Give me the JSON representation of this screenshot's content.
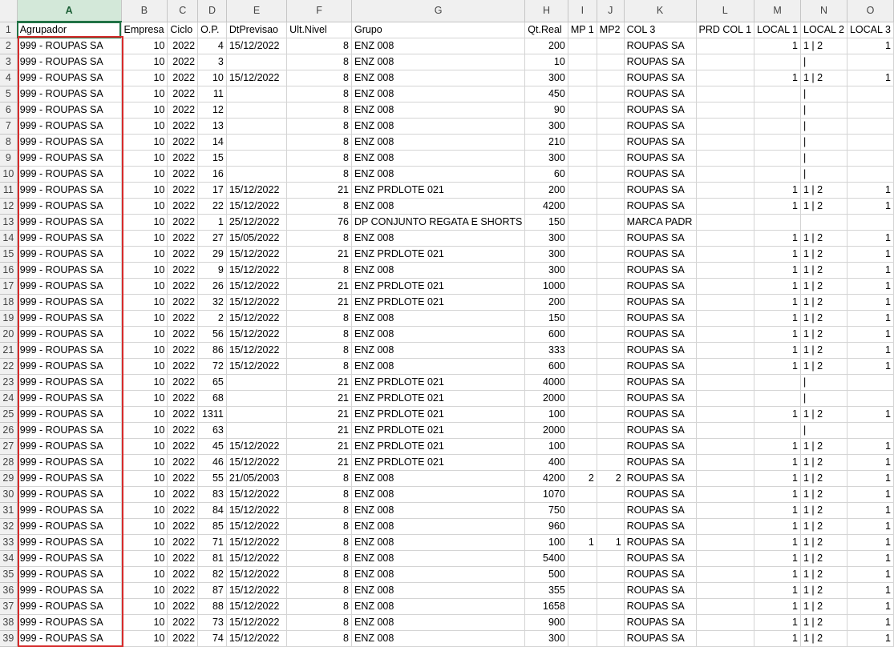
{
  "columns": [
    "A",
    "B",
    "C",
    "D",
    "E",
    "F",
    "G",
    "H",
    "I",
    "J",
    "K",
    "L",
    "M",
    "N",
    "O"
  ],
  "selected_column": "A",
  "selection_color": "#d62b2b",
  "accent_color": "#217346",
  "headers": [
    "Agrupador",
    "Empresa",
    "Ciclo",
    "O.P.",
    "DtPrevisao",
    "Ult.Nivel",
    "Grupo",
    "Qt.Real",
    "MP 1",
    "MP2",
    "COL 3",
    "PRD COL 1",
    "LOCAL 1",
    "LOCAL 2",
    "LOCAL 3"
  ],
  "rows": [
    {
      "n": "2",
      "cells": [
        "999 - ROUPAS SA",
        "10",
        "2022",
        "4",
        "15/12/2022",
        "8",
        "ENZ 008",
        "200",
        "",
        "",
        "ROUPAS SA",
        "",
        "1",
        "1 | 2",
        "1"
      ]
    },
    {
      "n": "3",
      "cells": [
        "999 - ROUPAS SA",
        "10",
        "2022",
        "3",
        "",
        "8",
        "ENZ 008",
        "10",
        "",
        "",
        "ROUPAS SA",
        "",
        "",
        "|",
        ""
      ]
    },
    {
      "n": "4",
      "cells": [
        "999 - ROUPAS SA",
        "10",
        "2022",
        "10",
        "15/12/2022",
        "8",
        "ENZ 008",
        "300",
        "",
        "",
        "ROUPAS SA",
        "",
        "1",
        "1 | 2",
        "1"
      ]
    },
    {
      "n": "5",
      "cells": [
        "999 - ROUPAS SA",
        "10",
        "2022",
        "11",
        "",
        "8",
        "ENZ 008",
        "450",
        "",
        "",
        "ROUPAS SA",
        "",
        "",
        "|",
        ""
      ]
    },
    {
      "n": "6",
      "cells": [
        "999 - ROUPAS SA",
        "10",
        "2022",
        "12",
        "",
        "8",
        "ENZ 008",
        "90",
        "",
        "",
        "ROUPAS SA",
        "",
        "",
        "|",
        ""
      ]
    },
    {
      "n": "7",
      "cells": [
        "999 - ROUPAS SA",
        "10",
        "2022",
        "13",
        "",
        "8",
        "ENZ 008",
        "300",
        "",
        "",
        "ROUPAS SA",
        "",
        "",
        "|",
        ""
      ]
    },
    {
      "n": "8",
      "cells": [
        "999 - ROUPAS SA",
        "10",
        "2022",
        "14",
        "",
        "8",
        "ENZ 008",
        "210",
        "",
        "",
        "ROUPAS SA",
        "",
        "",
        "|",
        ""
      ]
    },
    {
      "n": "9",
      "cells": [
        "999 - ROUPAS SA",
        "10",
        "2022",
        "15",
        "",
        "8",
        "ENZ 008",
        "300",
        "",
        "",
        "ROUPAS SA",
        "",
        "",
        "|",
        ""
      ]
    },
    {
      "n": "10",
      "cells": [
        "999 - ROUPAS SA",
        "10",
        "2022",
        "16",
        "",
        "8",
        "ENZ 008",
        "60",
        "",
        "",
        "ROUPAS SA",
        "",
        "",
        "|",
        ""
      ]
    },
    {
      "n": "11",
      "cells": [
        "999 - ROUPAS SA",
        "10",
        "2022",
        "17",
        "15/12/2022",
        "21",
        "ENZ PRDLOTE 021",
        "200",
        "",
        "",
        "ROUPAS SA",
        "",
        "1",
        "1 | 2",
        "1"
      ]
    },
    {
      "n": "12",
      "cells": [
        "999 - ROUPAS SA",
        "10",
        "2022",
        "22",
        "15/12/2022",
        "8",
        "ENZ 008",
        "4200",
        "",
        "",
        "ROUPAS SA",
        "",
        "1",
        "1 | 2",
        "1"
      ]
    },
    {
      "n": "13",
      "cells": [
        "999 - ROUPAS SA",
        "10",
        "2022",
        "1",
        "25/12/2022",
        "76",
        "DP CONJUNTO REGATA E SHORTS",
        "150",
        "",
        "",
        "MARCA PADR",
        "",
        "",
        "",
        ""
      ]
    },
    {
      "n": "14",
      "cells": [
        "999 - ROUPAS SA",
        "10",
        "2022",
        "27",
        "15/05/2022",
        "8",
        "ENZ 008",
        "300",
        "",
        "",
        "ROUPAS SA",
        "",
        "1",
        "1 | 2",
        "1"
      ]
    },
    {
      "n": "15",
      "cells": [
        "999 - ROUPAS SA",
        "10",
        "2022",
        "29",
        "15/12/2022",
        "21",
        "ENZ PRDLOTE 021",
        "300",
        "",
        "",
        "ROUPAS SA",
        "",
        "1",
        "1 | 2",
        "1"
      ]
    },
    {
      "n": "16",
      "cells": [
        "999 - ROUPAS SA",
        "10",
        "2022",
        "9",
        "15/12/2022",
        "8",
        "ENZ 008",
        "300",
        "",
        "",
        "ROUPAS SA",
        "",
        "1",
        "1 | 2",
        "1"
      ]
    },
    {
      "n": "17",
      "cells": [
        "999 - ROUPAS SA",
        "10",
        "2022",
        "26",
        "15/12/2022",
        "21",
        "ENZ PRDLOTE 021",
        "1000",
        "",
        "",
        "ROUPAS SA",
        "",
        "1",
        "1 | 2",
        "1"
      ]
    },
    {
      "n": "18",
      "cells": [
        "999 - ROUPAS SA",
        "10",
        "2022",
        "32",
        "15/12/2022",
        "21",
        "ENZ PRDLOTE 021",
        "200",
        "",
        "",
        "ROUPAS SA",
        "",
        "1",
        "1 | 2",
        "1"
      ]
    },
    {
      "n": "19",
      "cells": [
        "999 - ROUPAS SA",
        "10",
        "2022",
        "2",
        "15/12/2022",
        "8",
        "ENZ 008",
        "150",
        "",
        "",
        "ROUPAS SA",
        "",
        "1",
        "1 | 2",
        "1"
      ]
    },
    {
      "n": "20",
      "cells": [
        "999 - ROUPAS SA",
        "10",
        "2022",
        "56",
        "15/12/2022",
        "8",
        "ENZ 008",
        "600",
        "",
        "",
        "ROUPAS SA",
        "",
        "1",
        "1 | 2",
        "1"
      ]
    },
    {
      "n": "21",
      "cells": [
        "999 - ROUPAS SA",
        "10",
        "2022",
        "86",
        "15/12/2022",
        "8",
        "ENZ 008",
        "333",
        "",
        "",
        "ROUPAS SA",
        "",
        "1",
        "1 | 2",
        "1"
      ]
    },
    {
      "n": "22",
      "cells": [
        "999 - ROUPAS SA",
        "10",
        "2022",
        "72",
        "15/12/2022",
        "8",
        "ENZ 008",
        "600",
        "",
        "",
        "ROUPAS SA",
        "",
        "1",
        "1 | 2",
        "1"
      ]
    },
    {
      "n": "23",
      "cells": [
        "999 - ROUPAS SA",
        "10",
        "2022",
        "65",
        "",
        "21",
        "ENZ PRDLOTE 021",
        "4000",
        "",
        "",
        "ROUPAS SA",
        "",
        "",
        "|",
        ""
      ]
    },
    {
      "n": "24",
      "cells": [
        "999 - ROUPAS SA",
        "10",
        "2022",
        "68",
        "",
        "21",
        "ENZ PRDLOTE 021",
        "2000",
        "",
        "",
        "ROUPAS SA",
        "",
        "",
        "|",
        ""
      ]
    },
    {
      "n": "25",
      "cells": [
        "999 - ROUPAS SA",
        "10",
        "2022",
        "1311",
        "",
        "21",
        "ENZ PRDLOTE 021",
        "100",
        "",
        "",
        "ROUPAS SA",
        "",
        "1",
        "1 | 2",
        "1"
      ]
    },
    {
      "n": "26",
      "cells": [
        "999 - ROUPAS SA",
        "10",
        "2022",
        "63",
        "",
        "21",
        "ENZ PRDLOTE 021",
        "2000",
        "",
        "",
        "ROUPAS SA",
        "",
        "",
        "|",
        ""
      ]
    },
    {
      "n": "27",
      "cells": [
        "999 - ROUPAS SA",
        "10",
        "2022",
        "45",
        "15/12/2022",
        "21",
        "ENZ PRDLOTE 021",
        "100",
        "",
        "",
        "ROUPAS SA",
        "",
        "1",
        "1 | 2",
        "1"
      ]
    },
    {
      "n": "28",
      "cells": [
        "999 - ROUPAS SA",
        "10",
        "2022",
        "46",
        "15/12/2022",
        "21",
        "ENZ PRDLOTE 021",
        "400",
        "",
        "",
        "ROUPAS SA",
        "",
        "1",
        "1 | 2",
        "1"
      ]
    },
    {
      "n": "29",
      "cells": [
        "999 - ROUPAS SA",
        "10",
        "2022",
        "55",
        "21/05/2003",
        "8",
        "ENZ 008",
        "4200",
        "2",
        "2",
        "ROUPAS SA",
        "",
        "1",
        "1 | 2",
        "1"
      ]
    },
    {
      "n": "30",
      "cells": [
        "999 - ROUPAS SA",
        "10",
        "2022",
        "83",
        "15/12/2022",
        "8",
        "ENZ 008",
        "1070",
        "",
        "",
        "ROUPAS SA",
        "",
        "1",
        "1 | 2",
        "1"
      ]
    },
    {
      "n": "31",
      "cells": [
        "999 - ROUPAS SA",
        "10",
        "2022",
        "84",
        "15/12/2022",
        "8",
        "ENZ 008",
        "750",
        "",
        "",
        "ROUPAS SA",
        "",
        "1",
        "1 | 2",
        "1"
      ]
    },
    {
      "n": "32",
      "cells": [
        "999 - ROUPAS SA",
        "10",
        "2022",
        "85",
        "15/12/2022",
        "8",
        "ENZ 008",
        "960",
        "",
        "",
        "ROUPAS SA",
        "",
        "1",
        "1 | 2",
        "1"
      ]
    },
    {
      "n": "33",
      "cells": [
        "999 - ROUPAS SA",
        "10",
        "2022",
        "71",
        "15/12/2022",
        "8",
        "ENZ 008",
        "100",
        "1",
        "1",
        "ROUPAS SA",
        "",
        "1",
        "1 | 2",
        "1"
      ]
    },
    {
      "n": "34",
      "cells": [
        "999 - ROUPAS SA",
        "10",
        "2022",
        "81",
        "15/12/2022",
        "8",
        "ENZ 008",
        "5400",
        "",
        "",
        "ROUPAS SA",
        "",
        "1",
        "1 | 2",
        "1"
      ]
    },
    {
      "n": "35",
      "cells": [
        "999 - ROUPAS SA",
        "10",
        "2022",
        "82",
        "15/12/2022",
        "8",
        "ENZ 008",
        "500",
        "",
        "",
        "ROUPAS SA",
        "",
        "1",
        "1 | 2",
        "1"
      ]
    },
    {
      "n": "36",
      "cells": [
        "999 - ROUPAS SA",
        "10",
        "2022",
        "87",
        "15/12/2022",
        "8",
        "ENZ 008",
        "355",
        "",
        "",
        "ROUPAS SA",
        "",
        "1",
        "1 | 2",
        "1"
      ]
    },
    {
      "n": "37",
      "cells": [
        "999 - ROUPAS SA",
        "10",
        "2022",
        "88",
        "15/12/2022",
        "8",
        "ENZ 008",
        "1658",
        "",
        "",
        "ROUPAS SA",
        "",
        "1",
        "1 | 2",
        "1"
      ]
    },
    {
      "n": "38",
      "cells": [
        "999 - ROUPAS SA",
        "10",
        "2022",
        "73",
        "15/12/2022",
        "8",
        "ENZ 008",
        "900",
        "",
        "",
        "ROUPAS SA",
        "",
        "1",
        "1 | 2",
        "1"
      ]
    },
    {
      "n": "39",
      "cells": [
        "999 - ROUPAS SA",
        "10",
        "2022",
        "74",
        "15/12/2022",
        "8",
        "ENZ 008",
        "300",
        "",
        "",
        "ROUPAS SA",
        "",
        "1",
        "1 | 2",
        "1"
      ]
    }
  ]
}
